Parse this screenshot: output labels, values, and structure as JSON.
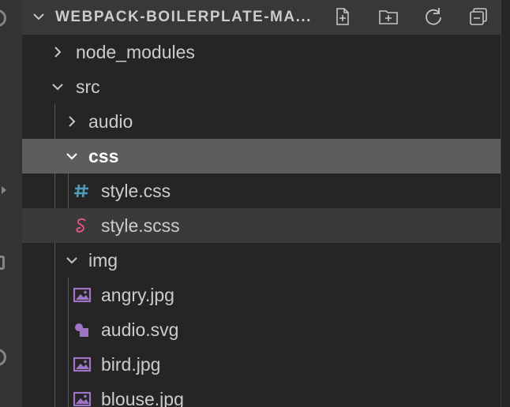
{
  "explorer": {
    "title": "WEBPACK-BOILERPLATE-MA...",
    "actions": [
      {
        "name": "new-file-icon"
      },
      {
        "name": "new-folder-icon"
      },
      {
        "name": "refresh-icon"
      },
      {
        "name": "collapse-all-icon"
      }
    ]
  },
  "tree": [
    {
      "label": "node_modules",
      "kind": "folder",
      "expanded": false,
      "depth": 0
    },
    {
      "label": "src",
      "kind": "folder",
      "expanded": true,
      "depth": 0
    },
    {
      "label": "audio",
      "kind": "folder",
      "expanded": false,
      "depth": 1
    },
    {
      "label": "css",
      "kind": "folder",
      "expanded": true,
      "depth": 1,
      "state": "selected"
    },
    {
      "label": "style.css",
      "kind": "file",
      "icon": "css-hash-icon",
      "depth": 2
    },
    {
      "label": "style.scss",
      "kind": "file",
      "icon": "sass-icon",
      "depth": 2,
      "state": "hover"
    },
    {
      "label": "img",
      "kind": "folder",
      "expanded": true,
      "depth": 1
    },
    {
      "label": "angry.jpg",
      "kind": "file",
      "icon": "image-icon",
      "depth": 2
    },
    {
      "label": "audio.svg",
      "kind": "file",
      "icon": "svg-icon",
      "depth": 2
    },
    {
      "label": "bird.jpg",
      "kind": "file",
      "icon": "image-icon",
      "depth": 2
    },
    {
      "label": "blouse.jpg",
      "kind": "file",
      "icon": "image-icon",
      "depth": 2
    }
  ],
  "colors": {
    "sidebar_bg": "#252526",
    "header_bg": "#383838",
    "selected_bg": "#5d5d5d",
    "hover_bg": "#3a3a3a",
    "text": "#cccccc",
    "css_icon": "#519aba",
    "sass_icon": "#f55385",
    "image_icon": "#a074c4"
  }
}
